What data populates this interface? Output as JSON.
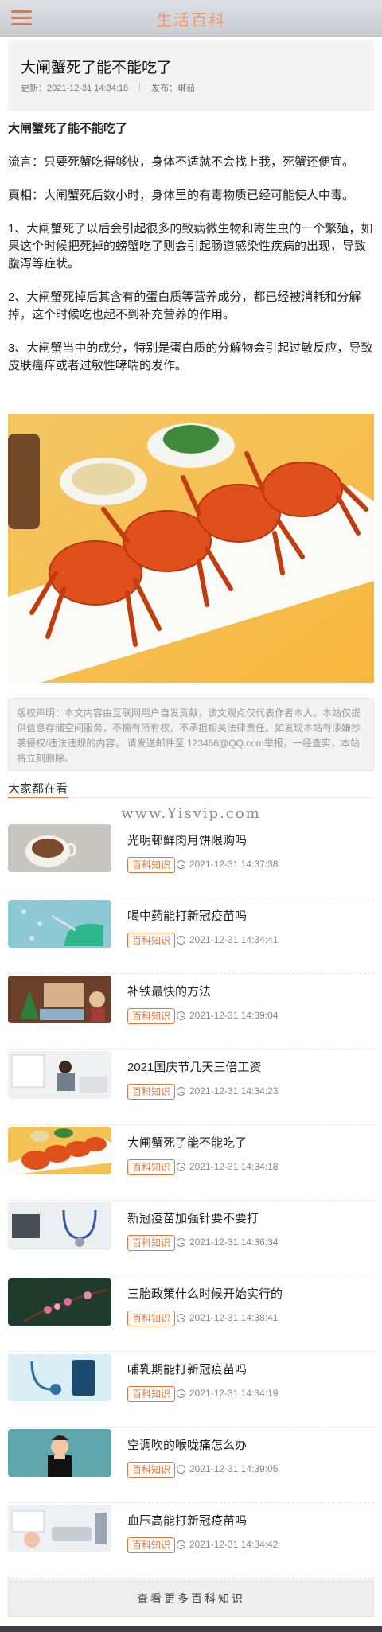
{
  "header": {
    "site_title": "生活百科",
    "menu_icon": "hamburger-menu-icon"
  },
  "article": {
    "title": "大闸蟹死了能不能吃了",
    "updated_label": "更新：2021-12-31 14:34:18",
    "publisher_label": "发布：琳茹",
    "heading": "大闸蟹死了能不能吃了",
    "paragraphs": [
      "流言：只要死蟹吃得够快，身体不适就不会找上我，死蟹还便宜。",
      "真相：大闸蟹死后数小时，身体里的有毒物质已经可能使人中毒。",
      "1、大闸蟹死了以后会引起很多的致病微生物和寄生虫的一个繁殖，如果这个时候把死掉的螃蟹吃了则会引起肠道感染性疾病的出现，导致腹泻等症状。",
      "2、大闸蟹死掉后其含有的蛋白质等营养成分，都已经被消耗和分解掉，这个时候吃也起不到补充营养的作用。",
      "3、大闸蟹当中的成分，特别是蛋白质的分解物会引起过敏反应，导致皮肤瘙痒或者过敏性哮喘的发作。"
    ]
  },
  "disclaimer": "版权声明：本文内容由互联网用户自发贡献，该文观点仅代表作者本人。本站仅提供信息存储空间服务，不拥有所有权，不承担相关法律责任。如发现本站有涉嫌抄袭侵权/违法违规的内容， 请发送邮件至 123456@QQ.com举报，一经查实，本站将立刻删除。",
  "related": {
    "section_title": "大家都在看",
    "watermark": "www.Yisvip.com",
    "items": [
      {
        "title": "光明邨鲜肉月饼限购吗",
        "tag": "百科知识",
        "time": "2021-12-31 14:37:38"
      },
      {
        "title": "喝中药能打新冠疫苗吗",
        "tag": "百科知识",
        "time": "2021-12-31 14:34:41"
      },
      {
        "title": "补铁最快的方法",
        "tag": "百科知识",
        "time": "2021-12-31 14:39:04"
      },
      {
        "title": "2021国庆节几天三倍工资",
        "tag": "百科知识",
        "time": "2021-12-31 14:34:23"
      },
      {
        "title": "大闸蟹死了能不能吃了",
        "tag": "百科知识",
        "time": "2021-12-31 14:34:18"
      },
      {
        "title": "新冠疫苗加强针要不要打",
        "tag": "百科知识",
        "time": "2021-12-31 14:36:34"
      },
      {
        "title": "三胎政策什么时候开始实行的",
        "tag": "百科知识",
        "time": "2021-12-31 14:38:41"
      },
      {
        "title": "哺乳期能打新冠疫苗吗",
        "tag": "百科知识",
        "time": "2021-12-31 14:34:19"
      },
      {
        "title": "空调吹的喉咙痛怎么办",
        "tag": "百科知识",
        "time": "2021-12-31 14:39:05"
      },
      {
        "title": "血压高能打新冠疫苗吗",
        "tag": "百科知识",
        "time": "2021-12-31 14:34:42"
      }
    ]
  },
  "more_button": "查看更多百科知识",
  "colors": {
    "accent": "#f0742f",
    "title": "#f29a6a"
  }
}
